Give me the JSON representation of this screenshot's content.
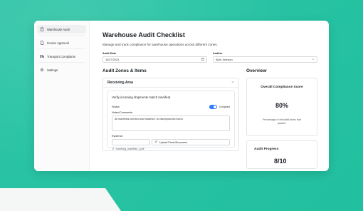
{
  "sidebar": {
    "items": [
      {
        "label": "Warehouse Audit",
        "icon": "clipboard-icon",
        "active": true
      },
      {
        "label": "Invoice Approval",
        "icon": "file-icon",
        "active": false
      },
      {
        "label": "Transport Complaints",
        "icon": "truck-icon",
        "active": false
      },
      {
        "label": "Settings",
        "icon": "gear-icon",
        "active": false
      }
    ]
  },
  "page": {
    "title": "Warehouse Audit Checklist",
    "subtitle": "Manage and track compliance for warehouse operations across different zones."
  },
  "form": {
    "audit_date_label": "Audit Date",
    "audit_date_value": "10/27/2023",
    "auditor_label": "Auditor",
    "auditor_value": "Alice Johnson"
  },
  "zones": {
    "section_title": "Audit Zones & Items",
    "zone_name": "Receiving Area",
    "item": {
      "text": "Verify incoming shipments match manifest.",
      "status_label": "Status",
      "status_value": "Compliant",
      "notes_label": "Notes/Comments",
      "notes_value": "All manifests checked and matched, no discrepancies found.",
      "evidence_label": "Evidence",
      "upload_label": "Upload Photo/Document",
      "file_name": "receiving_manifest_1.pdf"
    }
  },
  "overview": {
    "section_title": "Overview",
    "compliance_title": "Overall Compliance Score",
    "compliance_value": "80%",
    "compliance_desc": "Percentage of checklist items that passed.",
    "progress_title": "Audit Progress",
    "progress_value": "8/10"
  },
  "colors": {
    "background": "#27c3a3",
    "accent": "#2f7cf6"
  }
}
